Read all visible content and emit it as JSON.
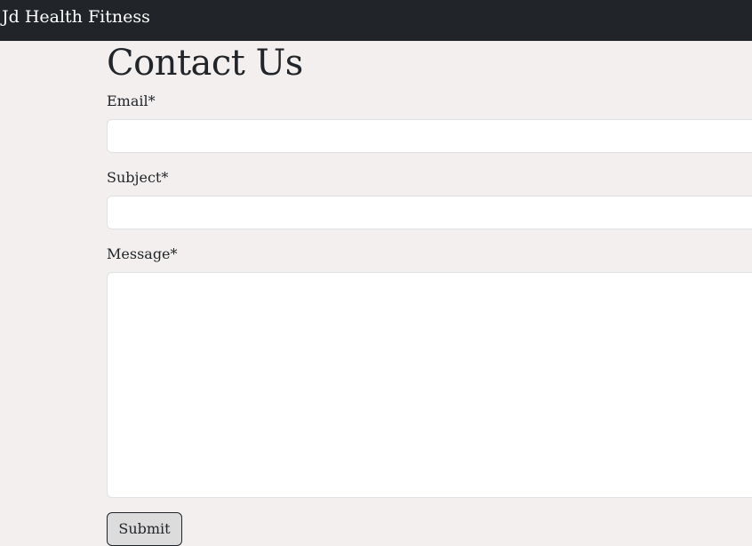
{
  "navbar": {
    "brand": "Jd Health Fitness"
  },
  "page": {
    "title": "Contact Us"
  },
  "form": {
    "email_label": "Email*",
    "email_value": "",
    "subject_label": "Subject*",
    "subject_value": "",
    "message_label": "Message*",
    "message_value": "",
    "submit_label": "Submit"
  },
  "colors": {
    "navbar_bg": "#212529",
    "page_bg": "#f2efee",
    "input_bg": "#ffffff"
  }
}
